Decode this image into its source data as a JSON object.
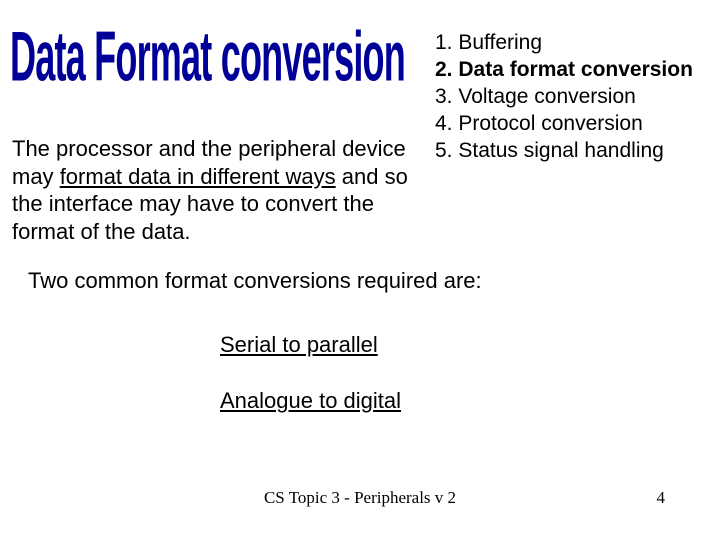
{
  "title": "Data Format conversion",
  "list_items": [
    {
      "num": "1.",
      "label": "Buffering",
      "bold": false
    },
    {
      "num": "2.",
      "label": "Data format conversion",
      "bold": true
    },
    {
      "num": "3.",
      "label": "Voltage conversion",
      "bold": false
    },
    {
      "num": "4.",
      "label": "Protocol conversion",
      "bold": false
    },
    {
      "num": "5.",
      "label": "Status signal handling",
      "bold": false
    }
  ],
  "paragraph1": {
    "pre": "The processor and the peripheral device may ",
    "u1": "format data in different ways",
    "post": " and so the interface may have to convert the format of the data."
  },
  "paragraph2": "Two common format conversions required are:",
  "link1": "Serial to parallel",
  "link2": "Analogue to digital",
  "footer_center": "CS Topic 3 - Peripherals v 2",
  "footer_right": "4"
}
